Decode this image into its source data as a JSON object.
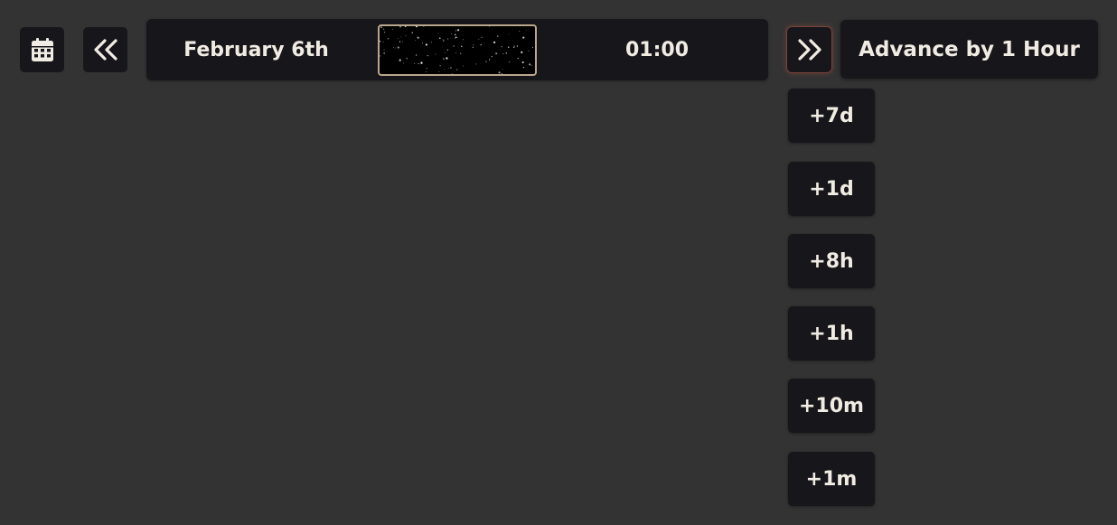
{
  "toolbar": {
    "calendar_icon": "calendar-icon",
    "rewind_icon": "double-chevron-left-icon",
    "forward_icon": "double-chevron-right-icon"
  },
  "timebar": {
    "date": "February 6th",
    "time": "01:00",
    "sky_preview": "night-sky-stars"
  },
  "advance": {
    "label": "Advance by 1 Hour"
  },
  "steps": [
    "+7d",
    "+1d",
    "+8h",
    "+1h",
    "+10m",
    "+1m"
  ],
  "colors": {
    "background": "#333333",
    "panel": "#17161b",
    "text": "#f1ece3",
    "sky_border": "#b9a78a",
    "forward_glow": "#c85a46"
  }
}
